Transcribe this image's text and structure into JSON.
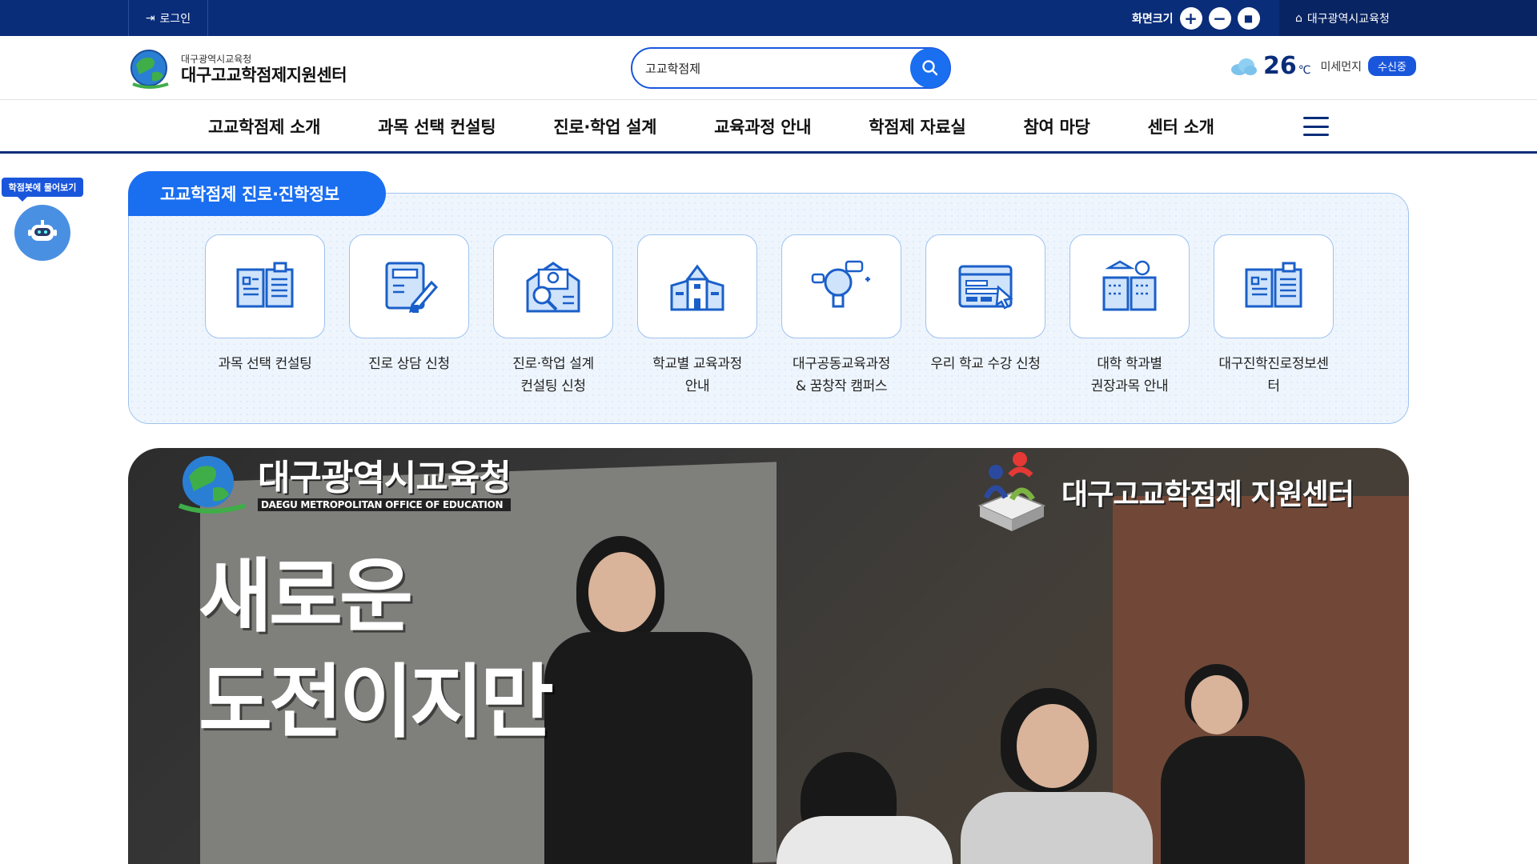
{
  "topbar": {
    "login_label": "로그인",
    "font_size_label": "화면크기",
    "zoom_in": "+",
    "zoom_out": "−",
    "zoom_reset": "■",
    "office_link": "대구광역시교육청"
  },
  "header": {
    "org_name": "대구광역시교육청",
    "site_name": "대구고교학점제지원센터",
    "search_value": "고교학점제",
    "weather_temp": "26",
    "weather_unit": "℃",
    "dust_label": "미세먼지",
    "dust_status": "수신중"
  },
  "nav": {
    "items": [
      "고교학점제 소개",
      "과목 선택 컨설팅",
      "진로·학업 설계",
      "교육과정 안내",
      "학점제 자료실",
      "참여 마당",
      "센터 소개"
    ]
  },
  "chatbot": {
    "label": "학점봇에 물어보기"
  },
  "info_panel": {
    "title": "고교학점제 진로·진학정보",
    "items": [
      {
        "label": "과목 선택 컨설팅",
        "icon": "open-book-icon"
      },
      {
        "label": "진로 상담 신청",
        "icon": "book-pen-icon"
      },
      {
        "label": "진로·학업 설계\n컨설팅 신청",
        "icon": "mail-search-icon"
      },
      {
        "label": "학교별 교육과정\n안내",
        "icon": "school-building-icon"
      },
      {
        "label": "대구공동교육과정\n& 꿈창작 캠퍼스",
        "icon": "lightbulb-chat-icon"
      },
      {
        "label": "우리 학교 수강 신청",
        "icon": "browser-click-icon"
      },
      {
        "label": "대학 학과별\n권장과목 안내",
        "icon": "university-book-icon"
      },
      {
        "label": "대구진학진로정보센터",
        "icon": "open-book-list-icon"
      }
    ]
  },
  "banner": {
    "left_logo_text": "대구광역시교육청",
    "left_logo_sub": "DAEGU METROPOLITAN OFFICE OF EDUCATION",
    "right_logo_text": "대구고교학점제 지원센터",
    "headline_line1": "새로운",
    "headline_line2": "도전이지만"
  },
  "colors": {
    "primary_navy": "#0a2d7a",
    "accent_blue": "#1a6ef0",
    "panel_bg": "#eef5fd",
    "panel_border": "#9ec3ee"
  }
}
